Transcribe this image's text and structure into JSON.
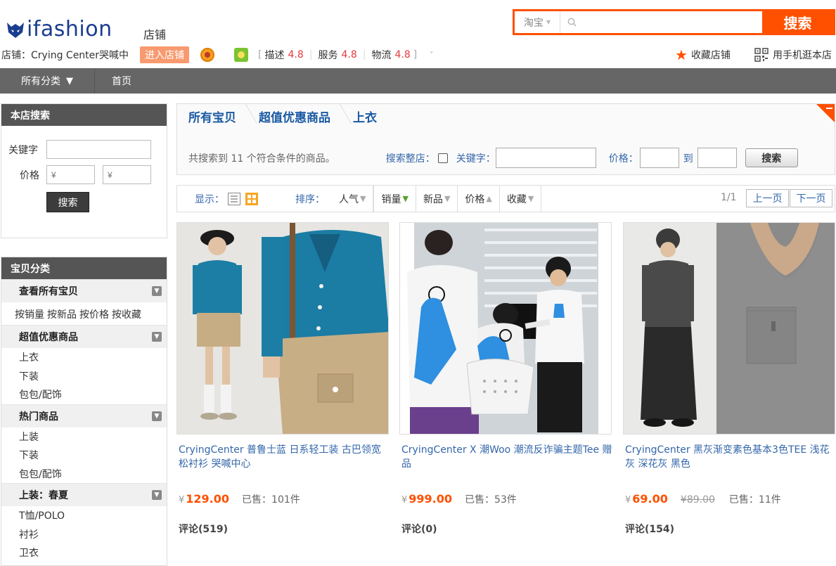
{
  "header": {
    "logo_text": "ifashion",
    "shop_word": "店铺",
    "search": {
      "scope": "淘宝",
      "placeholder": "",
      "button": "搜索"
    },
    "shop_label": "店铺：",
    "shop_name": "Crying Center哭喊中",
    "enter_shop": "进入店铺",
    "scores": [
      {
        "label": "描述",
        "value": "4.8"
      },
      {
        "label": "服务",
        "value": "4.8"
      },
      {
        "label": "物流",
        "value": "4.8"
      }
    ],
    "favorite": "收藏店铺",
    "mobile": "用手机逛本店",
    "colors": {
      "accent": "#ff5000",
      "nav": "#666666",
      "link": "#3366aa"
    }
  },
  "nav": {
    "all_categories": "所有分类",
    "home": "首页"
  },
  "sidebar": {
    "search": {
      "title": "本店搜索",
      "keyword_label": "关键字",
      "price_label": "价格",
      "price_min_placeholder": "¥",
      "price_max_placeholder": "¥",
      "button": "搜索"
    },
    "categories": {
      "title": "宝贝分类",
      "all": "查看所有宝贝",
      "sort_links": [
        "按销量",
        "按新品",
        "按价格",
        "按收藏"
      ],
      "groups": [
        {
          "name": "超值优惠商品",
          "items": [
            "上衣",
            "下装",
            "包包/配饰"
          ]
        },
        {
          "name": "热门商品",
          "items": [
            "上装",
            "下装",
            "包包/配饰"
          ]
        },
        {
          "name": "上装：春夏",
          "items": [
            "T恤/POLO",
            "衬衫",
            "卫衣"
          ]
        }
      ]
    }
  },
  "breadcrumb": [
    "所有宝贝",
    "超值优惠商品",
    "上衣"
  ],
  "filter": {
    "result_text": "共搜索到 11 个符合条件的商品。",
    "search_whole_shop": "搜索整店：",
    "keyword_label": "关键字：",
    "price_label": "价格：",
    "to": "到",
    "button": "搜索"
  },
  "sortbar": {
    "display_label": "显示：",
    "sort_label": "排序：",
    "options": [
      {
        "label": "人气",
        "arrow": "down",
        "active": false
      },
      {
        "label": "销量",
        "arrow": "down",
        "active": true
      },
      {
        "label": "新品",
        "arrow": "down",
        "active": false
      },
      {
        "label": "价格",
        "arrow": "up",
        "active": false
      },
      {
        "label": "收藏",
        "arrow": "down",
        "active": false
      }
    ],
    "page_count": "1/1",
    "prev": "上一页",
    "next": "下一页"
  },
  "products": [
    {
      "title": "CryingCenter 普鲁士蓝 日系轻工装 古巴领宽松衬衫 哭喊中心",
      "price": "129.00",
      "orig_price": "",
      "sold": "已售：101件",
      "reviews": "评论(519)",
      "image_desc": "blue-shirt-photo"
    },
    {
      "title": "CryingCenter X 潮Woo 潮流反诈骗主题Tee 赠品",
      "price": "999.00",
      "orig_price": "",
      "sold": "已售：53件",
      "reviews": "评论(0)",
      "image_desc": "white-tee-photo"
    },
    {
      "title": "CryingCenter 黑灰渐变素色基本3色TEE 浅花灰 深花灰 黑色",
      "price": "69.00",
      "orig_price": "89.00",
      "sold": "已售：11件",
      "reviews": "评论(154)",
      "image_desc": "grey-tee-photo"
    }
  ],
  "yen": "¥"
}
